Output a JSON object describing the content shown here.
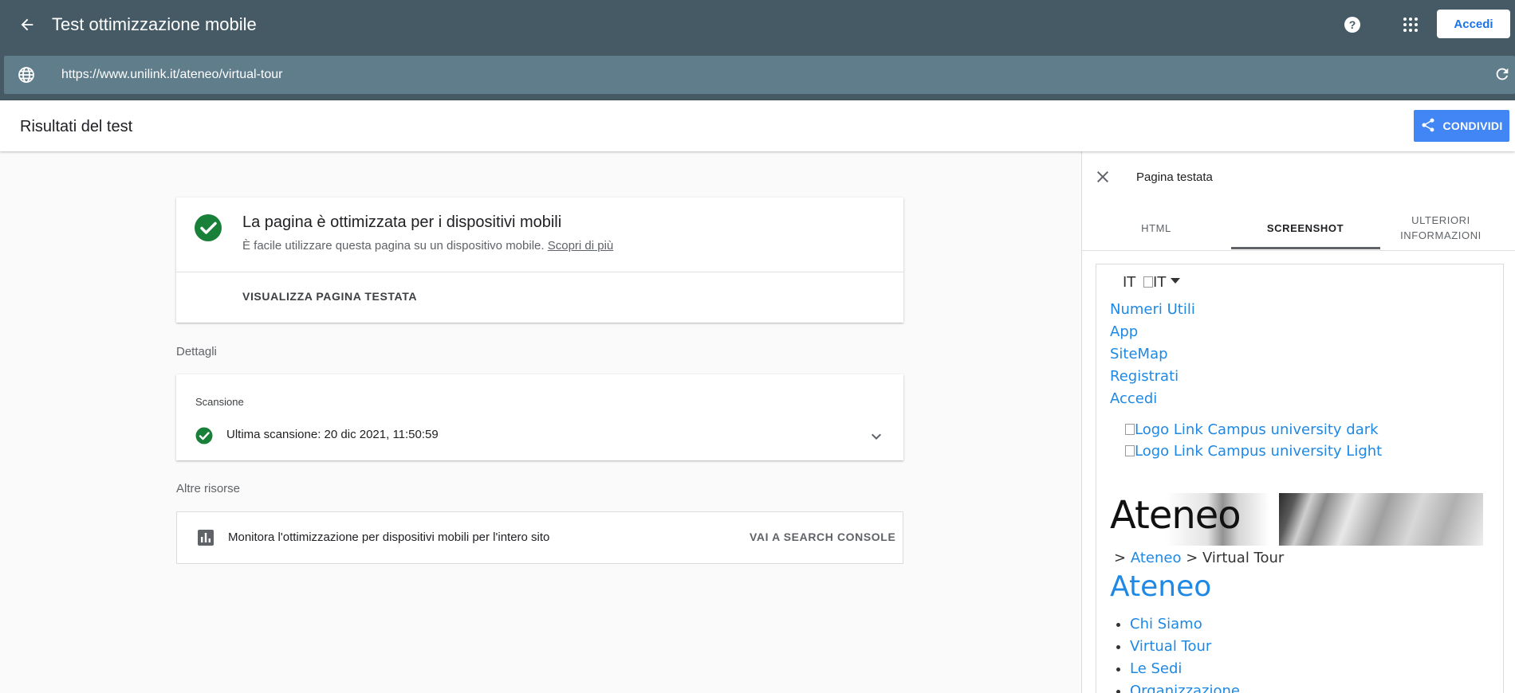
{
  "appbar": {
    "title": "Test ottimizzazione mobile",
    "login_label": "Accedi",
    "url": "https://www.unilink.it/ateneo/virtual-tour",
    "back_icon": "arrow-back-icon",
    "help_icon": "help-icon",
    "apps_icon": "apps-grid-icon",
    "globe_icon": "globe-icon",
    "reload_icon": "reload-icon"
  },
  "results": {
    "title": "Risultati del test",
    "share_label": "CONDIVIDI",
    "share_icon": "share-icon"
  },
  "main_card": {
    "heading": "La pagina è ottimizzata per i dispositivi mobili",
    "subtitle": "È facile utilizzare questa pagina su un dispositivo mobile.",
    "learn_more": "Scopri di più",
    "view_page": "VISUALIZZA PAGINA TESTATA"
  },
  "details": {
    "section_label": "Dettagli",
    "scan_label": "Scansione",
    "scan_text": "Ultima scansione: 20 dic 2021, 11:50:59"
  },
  "resources": {
    "section_label": "Altre risorse",
    "text": "Monitora l'ottimizzazione per dispositivi mobili per l'intero sito",
    "button": "VAI A SEARCH CONSOLE"
  },
  "panel": {
    "title": "Pagina testata",
    "tabs": [
      {
        "label": "HTML",
        "active": false
      },
      {
        "label": "SCREENSHOT",
        "active": true
      },
      {
        "label": "ULTERIORI INFORMAZIONI",
        "active": false
      }
    ],
    "screenshot": {
      "lang": "IT",
      "lang_img_alt": "IT",
      "nav_links": [
        "Numeri Utili",
        "App",
        "SiteMap",
        "Registrati",
        "Accedi"
      ],
      "logo_alts": [
        "Logo Link Campus university dark",
        "Logo Link Campus university Light"
      ],
      "hero_title": "Ateneo",
      "breadcrumb": {
        "sep": ">",
        "link": "Ateneo",
        "current": "Virtual Tour"
      },
      "page_heading": "Ateneo",
      "menu_items": [
        "Chi Siamo",
        "Virtual Tour",
        "Le Sedi",
        "Organizzazione"
      ]
    }
  },
  "colors": {
    "appbar": "#455a64",
    "urlbar": "#607d8b",
    "share": "#4285f4",
    "success": "#188038",
    "link": "#1e88e5"
  }
}
